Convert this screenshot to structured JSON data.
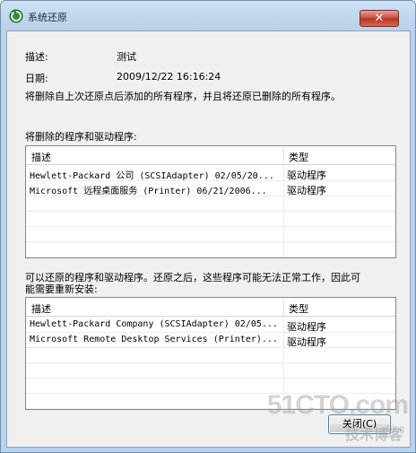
{
  "window": {
    "title": "系统还原",
    "close_label": "✕"
  },
  "info": {
    "description_label": "描述:",
    "description_value": "测试",
    "date_label": "日期:",
    "date_value": "2009/12/22 16:16:24",
    "summary": "将删除自上次还原点后添加的所有程序，并且将还原已删除的所有程序。"
  },
  "delete_section": {
    "heading": "将删除的程序和驱动程序:",
    "columns": [
      "描述",
      "类型"
    ],
    "rows": [
      {
        "desc": "Hewlett-Packard 公司 (SCSIAdapter) 02/05/20...",
        "type": "驱动程序"
      },
      {
        "desc": "Microsoft 远程桌面服务 (Printer) 06/21/2006...",
        "type": "驱动程序"
      }
    ]
  },
  "restore_section": {
    "heading_line1": "可以还原的程序和驱动程序。还原之后，这些程序可能无法正常工作，因此可",
    "heading_line2": "能需要重新安装:",
    "columns": [
      "描述",
      "类型"
    ],
    "rows": [
      {
        "desc": "Hewlett-Packard Company (SCSIAdapter) 02/05...",
        "type": "驱动程序"
      },
      {
        "desc": "Microsoft Remote Desktop Services (Printer)...",
        "type": "驱动程序"
      }
    ]
  },
  "footer": {
    "close_button": "关闭(C)"
  },
  "watermark": {
    "line1": "51CTO.com",
    "line2": "技术博客",
    "line3": "Blog"
  },
  "colors": {
    "frame": "#b9d1ea",
    "close_button": "#c9493a",
    "dialog_bg": "#f0f0f0"
  }
}
